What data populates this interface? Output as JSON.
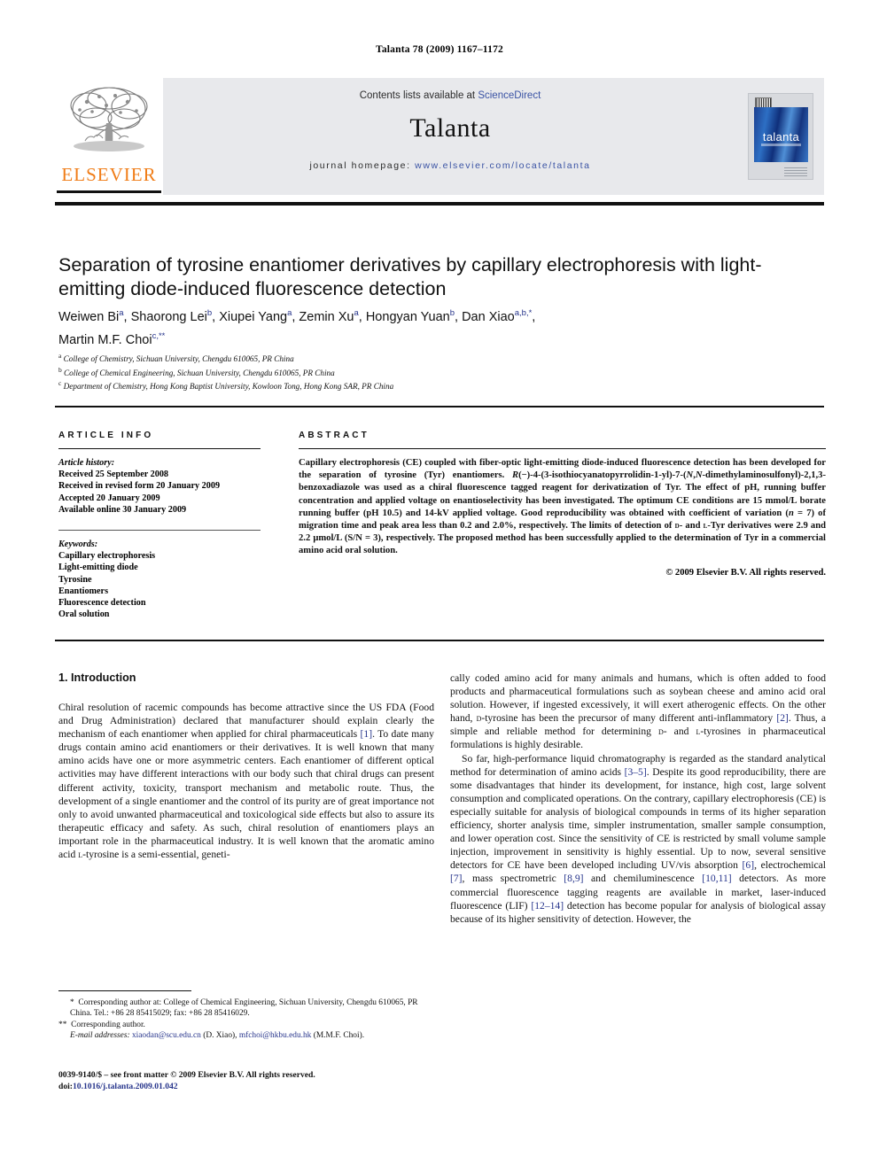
{
  "running_head": "Talanta 78 (2009) 1167–1172",
  "masthead": {
    "contents_prefix": "Contents lists available at ",
    "sciencedirect": "ScienceDirect",
    "journal_name": "Talanta",
    "homepage_prefix": "journal homepage: ",
    "homepage_url": "www.elsevier.com/locate/talanta",
    "publisher_wordmark": "ELSEVIER",
    "cover_wordmark": "talanta",
    "accent_orange": "#f07d18",
    "link_blue": "#3a53a4"
  },
  "article": {
    "title": "Separation of tyrosine enantiomer derivatives by capillary electrophoresis with light-emitting diode-induced fluorescence detection",
    "authors_line1_html": "Weiwen Bi<sup>a</sup>, Shaorong Lei<sup>b</sup>, Xiupei Yang<sup>a</sup>, Zemin Xu<sup>a</sup>, Hongyan Yuan<sup>b</sup>, Dan Xiao<sup>a,b,</sup><sup>*</sup>,",
    "authors_line2_html": "Martin M.F. Choi<sup>c,</sup><sup>**</sup>",
    "affiliations": [
      {
        "marker": "a",
        "text": "College of Chemistry, Sichuan University, Chengdu 610065, PR China"
      },
      {
        "marker": "b",
        "text": "College of Chemical Engineering, Sichuan University, Chengdu 610065, PR China"
      },
      {
        "marker": "c",
        "text": "Department of Chemistry, Hong Kong Baptist University, Kowloon Tong, Hong Kong SAR, PR China"
      }
    ]
  },
  "article_info": {
    "heading": "ARTICLE INFO",
    "history_label": "Article history:",
    "history": [
      "Received 25 September 2008",
      "Received in revised form 20 January 2009",
      "Accepted 20 January 2009",
      "Available online 30 January 2009"
    ],
    "keywords_label": "Keywords:",
    "keywords": [
      "Capillary electrophoresis",
      "Light-emitting diode",
      "Tyrosine",
      "Enantiomers",
      "Fluorescence detection",
      "Oral solution"
    ]
  },
  "abstract": {
    "heading": "ABSTRACT",
    "body_html": "Capillary electrophoresis (CE) coupled with fiber-optic light-emitting diode-induced fluorescence detection has been developed for the separation of tyrosine (Tyr) enantiomers. <i>R</i>(−)-4-(3-isothiocyanatopyrrolidin-1-yl)-7-(<i>N</i>,<i>N</i>-dimethylaminosulfonyl)-2,1,3-benzoxadiazole was used as a chiral fluorescence tagged reagent for derivatization of Tyr. The effect of pH, running buffer concentration and applied voltage on enantioselectivity has been investigated. The optimum CE conditions are 15 mmol/L borate running buffer (pH 10.5) and 14-kV applied voltage. Good reproducibility was obtained with coefficient of variation (<i>n</i> = 7) of migration time and peak area less than 0.2 and 2.0%, respectively. The limits of detection of <span class=\"sc\">d</span>- and <span class=\"sc\">l</span>-Tyr derivatives were 2.9 and 2.2 μmol/L (S/N = 3), respectively. The proposed method has been successfully applied to the determination of Tyr in a commercial amino acid oral solution.",
    "copyright": "© 2009 Elsevier B.V. All rights reserved."
  },
  "introduction": {
    "heading": "1. Introduction",
    "left_paragraph_html": "Chiral resolution of racemic compounds has become attractive since the US FDA (Food and Drug Administration) declared that manufacturer should explain clearly the mechanism of each enantiomer when applied for chiral pharmaceuticals <span class=\"ref\">[1]</span>. To date many drugs contain amino acid enantiomers or their derivatives. It is well known that many amino acids have one or more asymmetric centers. Each enantiomer of different optical activities may have different interactions with our body such that chiral drugs can present different activity, toxicity, transport mechanism and metabolic route. Thus, the development of a single enantiomer and the control of its purity are of great importance not only to avoid unwanted pharmaceutical and toxicological side effects but also to assure its therapeutic efficacy and safety. As such, chiral resolution of enantiomers plays an important role in the pharmaceutical industry. It is well known that the aromatic amino acid <span class=\"sc\">l</span>-tyrosine is a semi-essential, geneti-",
    "right_paragraph_1_html": "cally coded amino acid for many animals and humans, which is often added to food products and pharmaceutical formulations such as soybean cheese and amino acid oral solution. However, if ingested excessively, it will exert atherogenic effects. On the other hand, <span class=\"sc\">d</span>-tyrosine has been the precursor of many different anti-inflammatory <span class=\"ref\">[2]</span>. Thus, a simple and reliable method for determining <span class=\"sc\">d</span>- and <span class=\"sc\">l</span>-tyrosines in pharmaceutical formulations is highly desirable.",
    "right_paragraph_2_html": "So far, high-performance liquid chromatography is regarded as the standard analytical method for determination of amino acids <span class=\"ref\">[3–5]</span>. Despite its good reproducibility, there are some disadvantages that hinder its development, for instance, high cost, large solvent consumption and complicated operations. On the contrary, capillary electrophoresis (CE) is especially suitable for analysis of biological compounds in terms of its higher separation efficiency, shorter analysis time, simpler instrumentation, smaller sample consumption, and lower operation cost. Since the sensitivity of CE is restricted by small volume sample injection, improvement in sensitivity is highly essential. Up to now, several sensitive detectors for CE have been developed including UV/vis absorption <span class=\"ref\">[6]</span>, electrochemical <span class=\"ref\">[7]</span>, mass spectrometric <span class=\"ref\">[8,9]</span> and chemiluminescence <span class=\"ref\">[10,11]</span> detectors. As more commercial fluorescence tagging reagents are available in market, laser-induced fluorescence (LIF) <span class=\"ref\">[12–14]</span> detection has become popular for analysis of biological assay because of its higher sensitivity of detection. However, the"
  },
  "footnotes": {
    "corresponding_1_html": "<span class=\"star\">*</span>&nbsp; Corresponding author at: College of Chemical Engineering, Sichuan University, Chengdu 610065, PR China. Tel.: +86 28 85415029; fax: +86 28 85416029.",
    "corresponding_2_html": "<span class=\"star\">**</span>&nbsp; Corresponding author.",
    "emails_html": "<span class=\"em\">E-mail addresses:</span> <span class=\"mail\">xiaodan@scu.edu.cn</span> (D. Xiao), <span class=\"mail\">mfchoi@hkbu.edu.hk</span> (M.M.F. Choi).",
    "issn_line_html": "0039-9140/$ – see front matter © 2009 Elsevier B.V. All rights reserved.",
    "doi_line_html": "doi:<span class=\"doi\">10.1016/j.talanta.2009.01.042</span>"
  }
}
